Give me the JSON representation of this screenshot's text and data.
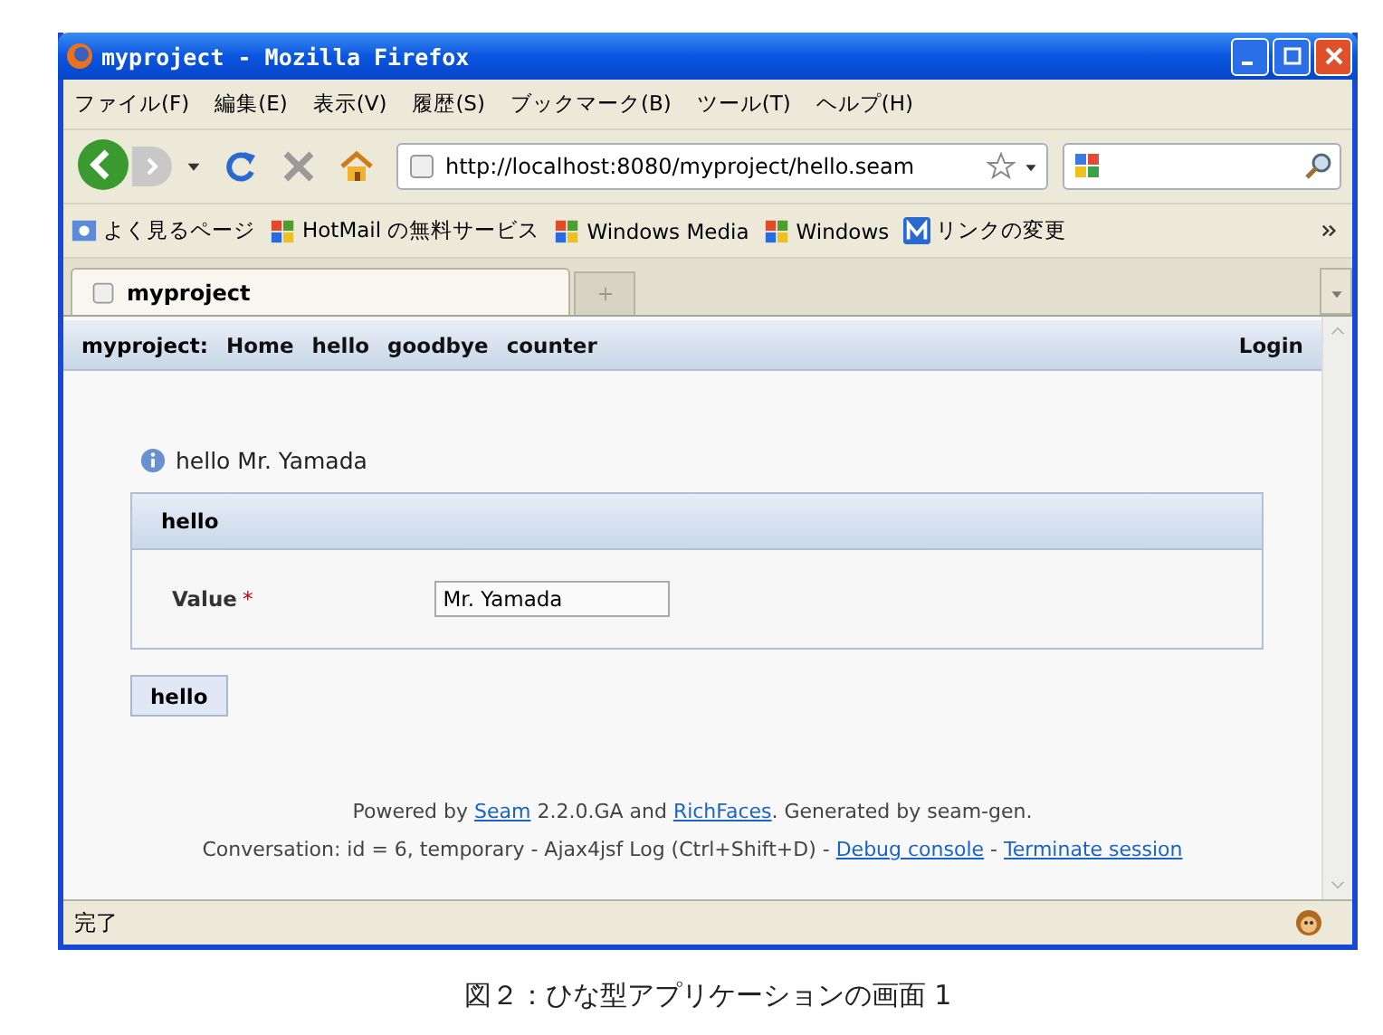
{
  "window": {
    "title": "myproject - Mozilla Firefox"
  },
  "menu": [
    "ファイル(F)",
    "編集(E)",
    "表示(V)",
    "履歴(S)",
    "ブックマーク(B)",
    "ツール(T)",
    "ヘルプ(H)"
  ],
  "address": {
    "value": "http://localhost:8080/myproject/hello.seam"
  },
  "bookmarks": [
    {
      "label": "よく見るページ",
      "kind": "page"
    },
    {
      "label": "HotMail の無料サービス",
      "kind": "windows"
    },
    {
      "label": "Windows Media",
      "kind": "windows"
    },
    {
      "label": "Windows",
      "kind": "windows"
    },
    {
      "label": "リンクの変更",
      "kind": "m"
    }
  ],
  "tabs": [
    {
      "label": "myproject",
      "selected": true
    }
  ],
  "app_nav": {
    "brand": "myproject:",
    "links": [
      "Home",
      "hello",
      "goodbye",
      "counter"
    ],
    "login": "Login"
  },
  "message": "hello Mr. Yamada",
  "panel": {
    "title": "hello",
    "field": {
      "label": "Value",
      "required": "*",
      "value": "Mr. Yamada"
    }
  },
  "button": "hello",
  "footer": [
    [
      {
        "text": "Powered by ",
        "link": false
      },
      {
        "text": "Seam",
        "link": true
      },
      {
        "text": " 2.2.0.GA and ",
        "link": false
      },
      {
        "text": "RichFaces",
        "link": true
      },
      {
        "text": ". Generated by seam-gen.",
        "link": false
      }
    ],
    [
      {
        "text": "Conversation: id = 6, temporary - Ajax4jsf Log (Ctrl+Shift+D) - ",
        "link": false
      },
      {
        "text": "Debug console",
        "link": true
      },
      {
        "text": " - ",
        "link": false
      },
      {
        "text": "Terminate session",
        "link": true
      }
    ]
  ],
  "status_bar": "完了",
  "caption": "図２：ひな型アプリケーションの画面 1"
}
